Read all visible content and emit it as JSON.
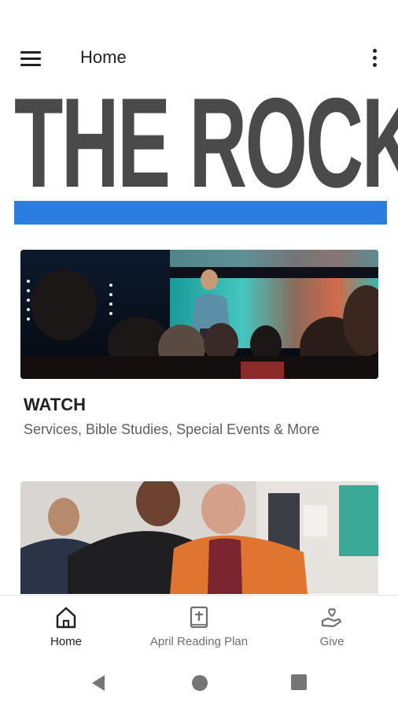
{
  "app_bar": {
    "title": "Home"
  },
  "logo": {
    "text": "THE ROCK"
  },
  "cards": [
    {
      "title": "WATCH",
      "subtitle": "Services, Bible Studies, Special Events & More"
    }
  ],
  "bottom_nav": {
    "items": [
      {
        "label": "Home",
        "icon": "home-icon",
        "active": true
      },
      {
        "label": "April Reading Plan",
        "icon": "bible-icon",
        "active": false
      },
      {
        "label": "Give",
        "icon": "give-heart-hand-icon",
        "active": false
      }
    ]
  },
  "system_nav": {
    "buttons": [
      "back-icon",
      "home-circle-icon",
      "recents-square-icon"
    ]
  },
  "colors": {
    "accent_blue": "#2b7de0",
    "logo_gray": "#4a4a4a",
    "text_secondary": "#6f6f6f"
  }
}
